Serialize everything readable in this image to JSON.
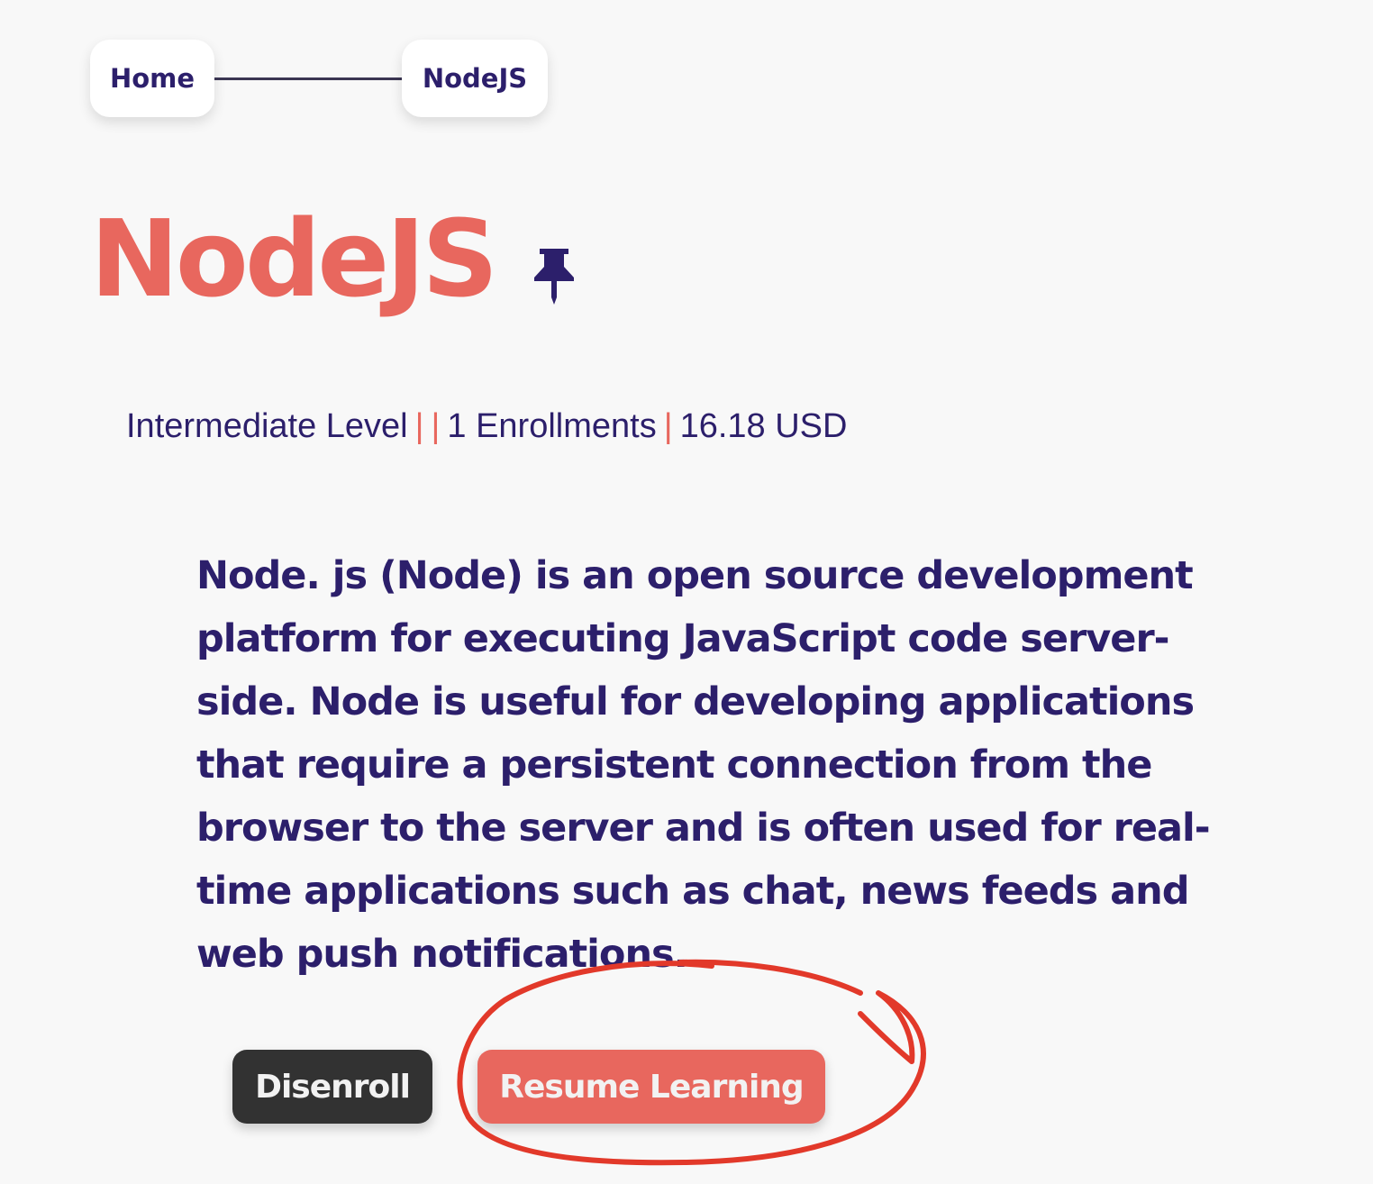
{
  "breadcrumb": {
    "home_label": "Home",
    "current_label": "NodeJS"
  },
  "course": {
    "title": "NodeJS",
    "pin_icon": "pin-icon",
    "level": "Intermediate Level",
    "separator": "|",
    "enrollments": "1 Enrollments",
    "price": "16.18 USD",
    "description": "Node. js (Node) is an open source development platform for executing JavaScript code server-side. Node is useful for developing applications that require a persistent connection from the browser to the server and is often used for real-time applications such as chat, news feeds and web push notifications."
  },
  "actions": {
    "disenroll_label": "Disenroll",
    "resume_label": "Resume Learning"
  },
  "colors": {
    "accent": "#e8675e",
    "text": "#2c1f6b",
    "dark_button": "#323232",
    "background": "#f8f8f8",
    "annotation": "#e2392a"
  }
}
